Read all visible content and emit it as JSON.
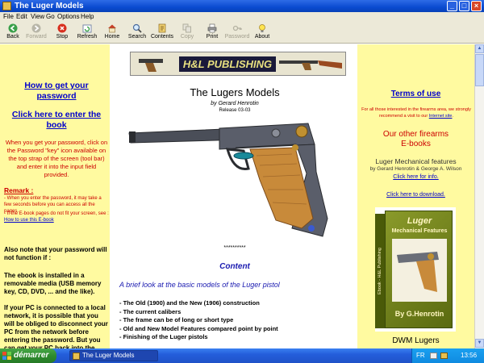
{
  "window": {
    "title": "The Luger Models"
  },
  "menu": [
    "File",
    "Edit",
    "View",
    "Go",
    "Options",
    "Help"
  ],
  "toolbar": {
    "back": "Back",
    "forward": "Forward",
    "stop": "Stop",
    "refresh": "Refresh",
    "home": "Home",
    "search": "Search",
    "contents": "Contents",
    "copy": "Copy",
    "print": "Print",
    "password": "Password",
    "about": "About"
  },
  "banner": {
    "text": "H&L PUBLISHING"
  },
  "left": {
    "password_link": "How to get your password",
    "enter_link": "Click here to enter the book",
    "instructions": "When you get your password, click on the Password \"key\" icon available on the top strap of the screen (tool bar) and enter it into the input field provided.",
    "remark_title": "Remark :",
    "remark_1": "- When you enter the password, it may take a few seconds before you can access all the pages.",
    "remark_2_prefix": "- If the E-book pages do not fit your screen, see : ",
    "remark_2_link": "How to use this E-book",
    "note_1": "Also note that your password will not function if :",
    "note_2": "The ebook is installed in a removable media (USB memory key, CD, DVD, ... and the like).",
    "note_3": "If your PC is connected to a local network, it is possible that you will be obliged to disconnect your PC from the network before entering the password. But you can get your PC back into the network after."
  },
  "center": {
    "title": "The Lugers Models",
    "author": "by Gerard Henrotin",
    "release": "Release 03-03",
    "stars": "**********",
    "content_heading": "Content",
    "intro": "A brief look at the basic models of the Luger pistol",
    "bullets": [
      "- The Old (1900) and the New (1906) construction",
      "- The current calibers",
      "- The frame can be of long or short type",
      "- Old and New Model Features compared point by point",
      "- Finishing of the Luger pistols"
    ]
  },
  "right": {
    "terms": "Terms of use",
    "terms_text_prefix": "For all those interested in the firearms area, we strongly recommend a visit to our ",
    "terms_text_link": "Internet site",
    "terms_text_suffix": ".",
    "other_heading_1": "Our other firearms",
    "other_heading_2": "E-books",
    "book_title": "Luger Mechanical features",
    "book_authors": "by Gerard Henrotin & George A. Wilson",
    "info_link": "Click here for info.",
    "download_link": "Click here to download.",
    "cover_title_1": "Luger",
    "cover_title_2": "Mechanical Features",
    "cover_spine": "Ebook - H&L Publishing",
    "cover_author": "By G.Henrotin",
    "dwm": "DWM Lugers"
  },
  "taskbar": {
    "start": "démarrer",
    "task": "The Luger Models",
    "lang": "FR",
    "clock": "13:56"
  },
  "colors": {
    "page_bg": "#fffaa0",
    "link": "#0000cc",
    "alert": "#cc0000",
    "heading": "#1a1ab0"
  }
}
